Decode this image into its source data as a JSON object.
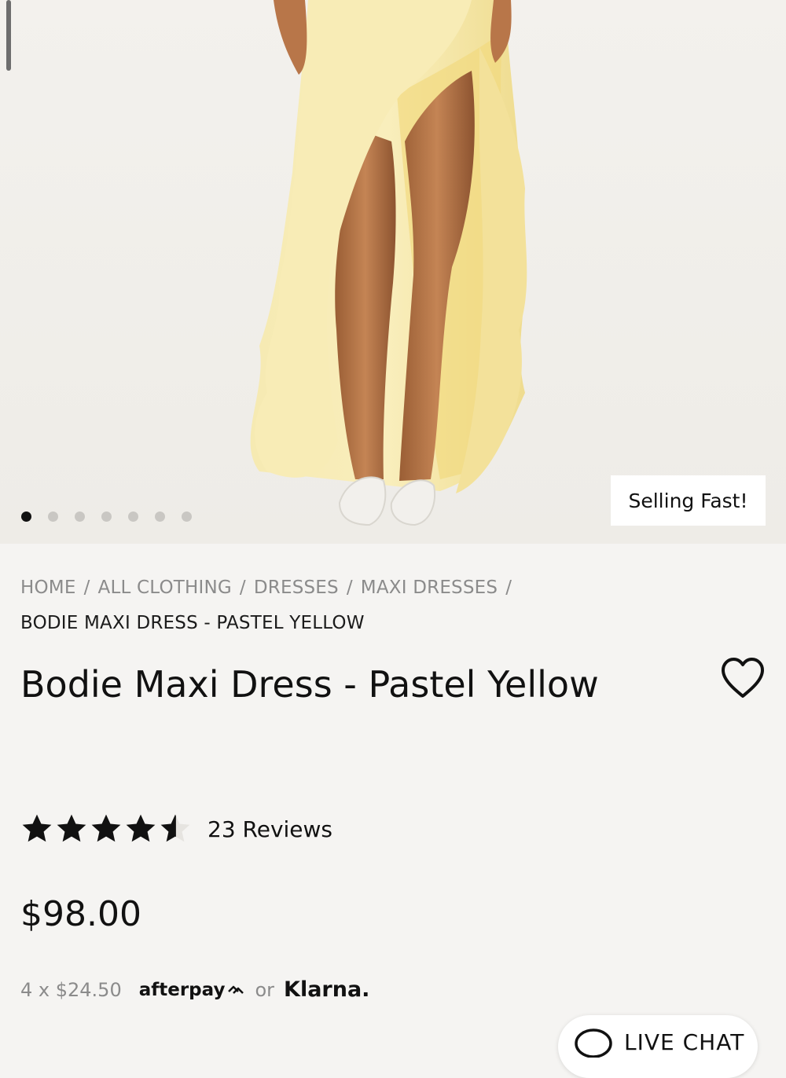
{
  "product_image": {
    "description_icon": "dress-photo",
    "badge": "Selling Fast!",
    "carousel": {
      "total": 7,
      "active_index": 0
    }
  },
  "breadcrumb": {
    "items": [
      "HOME",
      "ALL CLOTHING",
      "DRESSES",
      "MAXI DRESSES"
    ],
    "current": "BODIE MAXI DRESS - PASTEL YELLOW"
  },
  "product": {
    "title": "Bodie Maxi Dress - Pastel Yellow",
    "rating": 4.5,
    "rating_max": 5,
    "reviews_label": "23 Reviews",
    "price": "$98.00"
  },
  "payment": {
    "installments": "4 x $24.50",
    "afterpay": "afterpay",
    "or": "or",
    "klarna": "Klarna."
  },
  "live_chat": {
    "label": "LIVE CHAT"
  },
  "colors": {
    "background": "#f5f4f2",
    "dress": "#f7e9a8",
    "text": "#111111",
    "muted": "#8b8b8b"
  },
  "icons": [
    "heart-icon",
    "star-icon",
    "half-star-icon",
    "afterpay-logo-icon",
    "chat-bubble-icon"
  ]
}
